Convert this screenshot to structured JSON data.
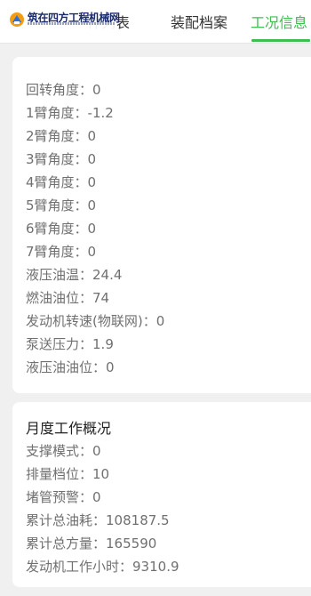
{
  "header": {
    "logo_text": "筑在四方工程机械网",
    "tabs": [
      {
        "label": "件列表",
        "active": false
      },
      {
        "label": "装配档案",
        "active": false
      },
      {
        "label": "工况信息",
        "active": true
      }
    ]
  },
  "realtime": {
    "items": [
      {
        "label": "回转角度：",
        "value": "0"
      },
      {
        "label": "1臂角度：",
        "value": "-1.2"
      },
      {
        "label": "2臂角度：",
        "value": "0"
      },
      {
        "label": "3臂角度：",
        "value": "0"
      },
      {
        "label": "4臂角度：",
        "value": "0"
      },
      {
        "label": "5臂角度：",
        "value": "0"
      },
      {
        "label": "6臂角度：",
        "value": "0"
      },
      {
        "label": "7臂角度：",
        "value": "0"
      },
      {
        "label": "液压油温：",
        "value": "24.4"
      },
      {
        "label": "燃油油位：",
        "value": "74"
      },
      {
        "label": "发动机转速(物联网)：",
        "value": "0"
      },
      {
        "label": "泵送压力：",
        "value": "1.9"
      },
      {
        "label": "液压油油位：",
        "value": "0"
      }
    ]
  },
  "monthly": {
    "title": "月度工作概况",
    "items": [
      {
        "label": "支撑模式：",
        "value": "0"
      },
      {
        "label": "排量档位：",
        "value": "10"
      },
      {
        "label": "堵管预警：",
        "value": "0"
      },
      {
        "label": "累计总油耗：",
        "value": "108187.5"
      },
      {
        "label": "累计总方量：",
        "value": "165590"
      },
      {
        "label": "发动机工作小时：",
        "value": "9310.9"
      }
    ]
  },
  "colors": {
    "accent": "#3cbf4f",
    "page_bg": "#f0f0f0",
    "card_bg": "#ffffff",
    "label_text": "#707070"
  }
}
